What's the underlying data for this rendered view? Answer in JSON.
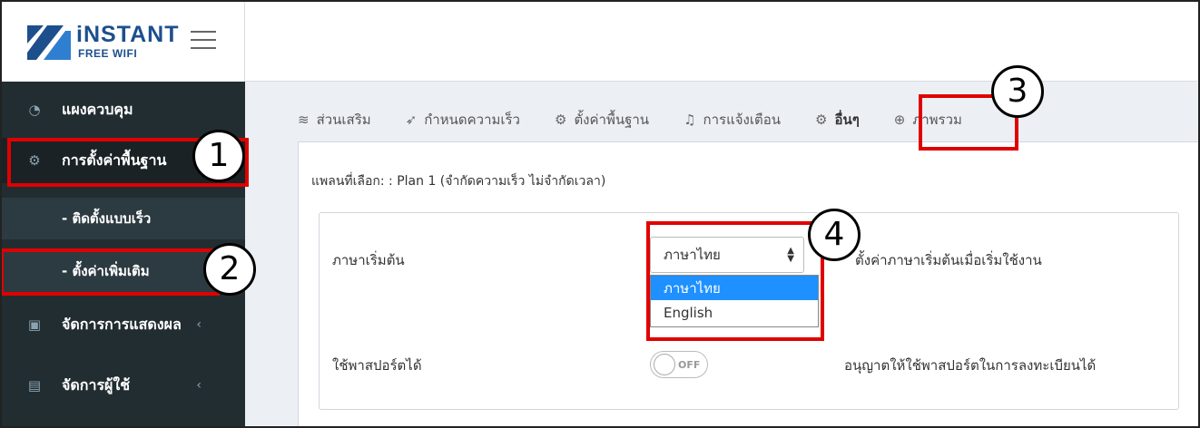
{
  "header": {
    "logo_text": "iNSTANT",
    "logo_sub": "FREE WIFI",
    "menu_icon": "hamburger-icon"
  },
  "sidebar": {
    "items": [
      {
        "label": "แผงควบคุม",
        "icon": "dashboard-icon"
      },
      {
        "label": "การตั้งค่าพื้นฐาน",
        "icon": "gear-icon"
      },
      {
        "label": "- ติดตั้งแบบเร็ว"
      },
      {
        "label": "- ตั้งค่าเพิ่มเติม"
      },
      {
        "label": "จัดการการแสดงผล",
        "icon": "image-icon"
      },
      {
        "label": "จัดการผู้ใช้",
        "icon": "user-card-icon"
      }
    ]
  },
  "tabs": [
    {
      "label": "ส่วนเสริม",
      "icon": "layers-icon"
    },
    {
      "label": "กำหนดความเร็ว",
      "icon": "rocket-icon"
    },
    {
      "label": "ตั้งค่าพื้นฐาน",
      "icon": "gear-icon"
    },
    {
      "label": "การแจ้งเตือน",
      "icon": "bell-icon"
    },
    {
      "label": "อื่นๆ",
      "icon": "gears-icon"
    },
    {
      "label": "ภาพรวม",
      "icon": "globe-icon"
    }
  ],
  "plan": {
    "text": "แพลนที่เลือก: : Plan 1 (จำกัดความเร็ว ไม่จำกัดเวลา)"
  },
  "settings": {
    "language_label": "ภาษาเริ่มต้น",
    "language_value": "ภาษาไทย",
    "language_help": "ตั้งค่าภาษาเริ่มต้นเมื่อเริ่มใช้งาน",
    "language_options": [
      "ภาษาไทย",
      "English"
    ],
    "passport_label": "ใช้พาสปอร์ตได้",
    "passport_toggle": "OFF",
    "passport_help": "อนุญาตให้ใช้พาสปอร์ตในการลงทะเบียนได้"
  },
  "annotations": {
    "n1": "1",
    "n2": "2",
    "n3": "3",
    "n4": "4",
    "highlight_color": "#e00000"
  }
}
